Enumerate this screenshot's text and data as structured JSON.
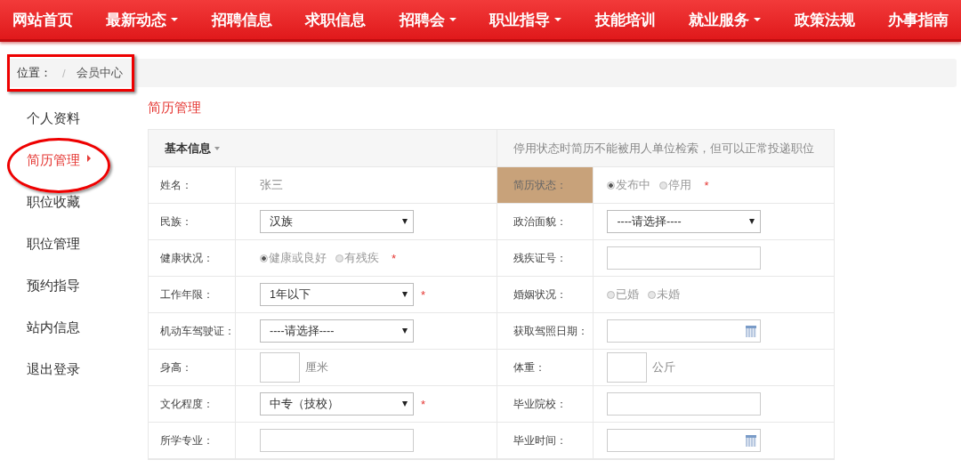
{
  "nav": [
    {
      "label": "网站首页",
      "dropdown": false
    },
    {
      "label": "最新动态",
      "dropdown": true
    },
    {
      "label": "招聘信息",
      "dropdown": false
    },
    {
      "label": "求职信息",
      "dropdown": false
    },
    {
      "label": "招聘会",
      "dropdown": true
    },
    {
      "label": "职业指导",
      "dropdown": true
    },
    {
      "label": "技能培训",
      "dropdown": false
    },
    {
      "label": "就业服务",
      "dropdown": true
    },
    {
      "label": "政策法规",
      "dropdown": false
    },
    {
      "label": "办事指南",
      "dropdown": false
    }
  ],
  "breadcrumb": {
    "label": "位置：",
    "separator": "/",
    "current": "会员中心",
    "boxed": true
  },
  "sidebar": {
    "items": [
      {
        "label": "个人资料",
        "selected": false,
        "circled": false
      },
      {
        "label": "简历管理",
        "selected": true,
        "circled": true
      },
      {
        "label": "职位收藏",
        "selected": false,
        "circled": false
      },
      {
        "label": "职位管理",
        "selected": false,
        "circled": false
      },
      {
        "label": "预约指导",
        "selected": false,
        "circled": false
      },
      {
        "label": "站内信息",
        "selected": false,
        "circled": false
      },
      {
        "label": "退出登录",
        "selected": false,
        "circled": false
      }
    ]
  },
  "page_title": "简历管理",
  "form": {
    "section": "基本信息",
    "note": "停用状态时简历不能被用人单位检索，但可以正常投递职位",
    "rows": [
      [
        {
          "label": "姓名：",
          "kind": "text",
          "value": "张三"
        },
        {
          "label": "简历状态：",
          "highlighted": true,
          "kind": "radio",
          "required_mark": "*",
          "options": [
            {
              "label": "发布中",
              "selected": true
            },
            {
              "label": "停用",
              "selected": false
            }
          ]
        }
      ],
      [
        {
          "label": "民族：",
          "kind": "select",
          "value": "汉族"
        },
        {
          "label": "政治面貌：",
          "kind": "select",
          "value": "----请选择----"
        }
      ],
      [
        {
          "label": "健康状况：",
          "kind": "radio",
          "required_mark": "*",
          "options": [
            {
              "label": "健康或良好",
              "selected": true
            },
            {
              "label": "有残疾",
              "selected": false
            }
          ]
        },
        {
          "label": "残疾证号：",
          "kind": "input"
        }
      ],
      [
        {
          "label": "工作年限：",
          "kind": "select",
          "value": "1年以下",
          "required_mark": "*"
        },
        {
          "label": "婚姻状况：",
          "kind": "radio",
          "options": [
            {
              "label": "已婚",
              "selected": false
            },
            {
              "label": "未婚",
              "selected": false
            }
          ]
        }
      ],
      [
        {
          "label": "机动车驾驶证：",
          "kind": "select",
          "value": "----请选择----"
        },
        {
          "label": "获取驾照日期：",
          "kind": "date"
        }
      ],
      [
        {
          "label": "身高：",
          "kind": "small",
          "unit": "厘米"
        },
        {
          "label": "体重：",
          "kind": "small",
          "unit": "公斤"
        }
      ],
      [
        {
          "label": "文化程度：",
          "kind": "select",
          "value": "中专（技校）",
          "required_mark": "*"
        },
        {
          "label": "毕业院校：",
          "kind": "input"
        }
      ],
      [
        {
          "label": "所学专业：",
          "kind": "input"
        },
        {
          "label": "毕业时间：",
          "kind": "date"
        }
      ]
    ]
  }
}
